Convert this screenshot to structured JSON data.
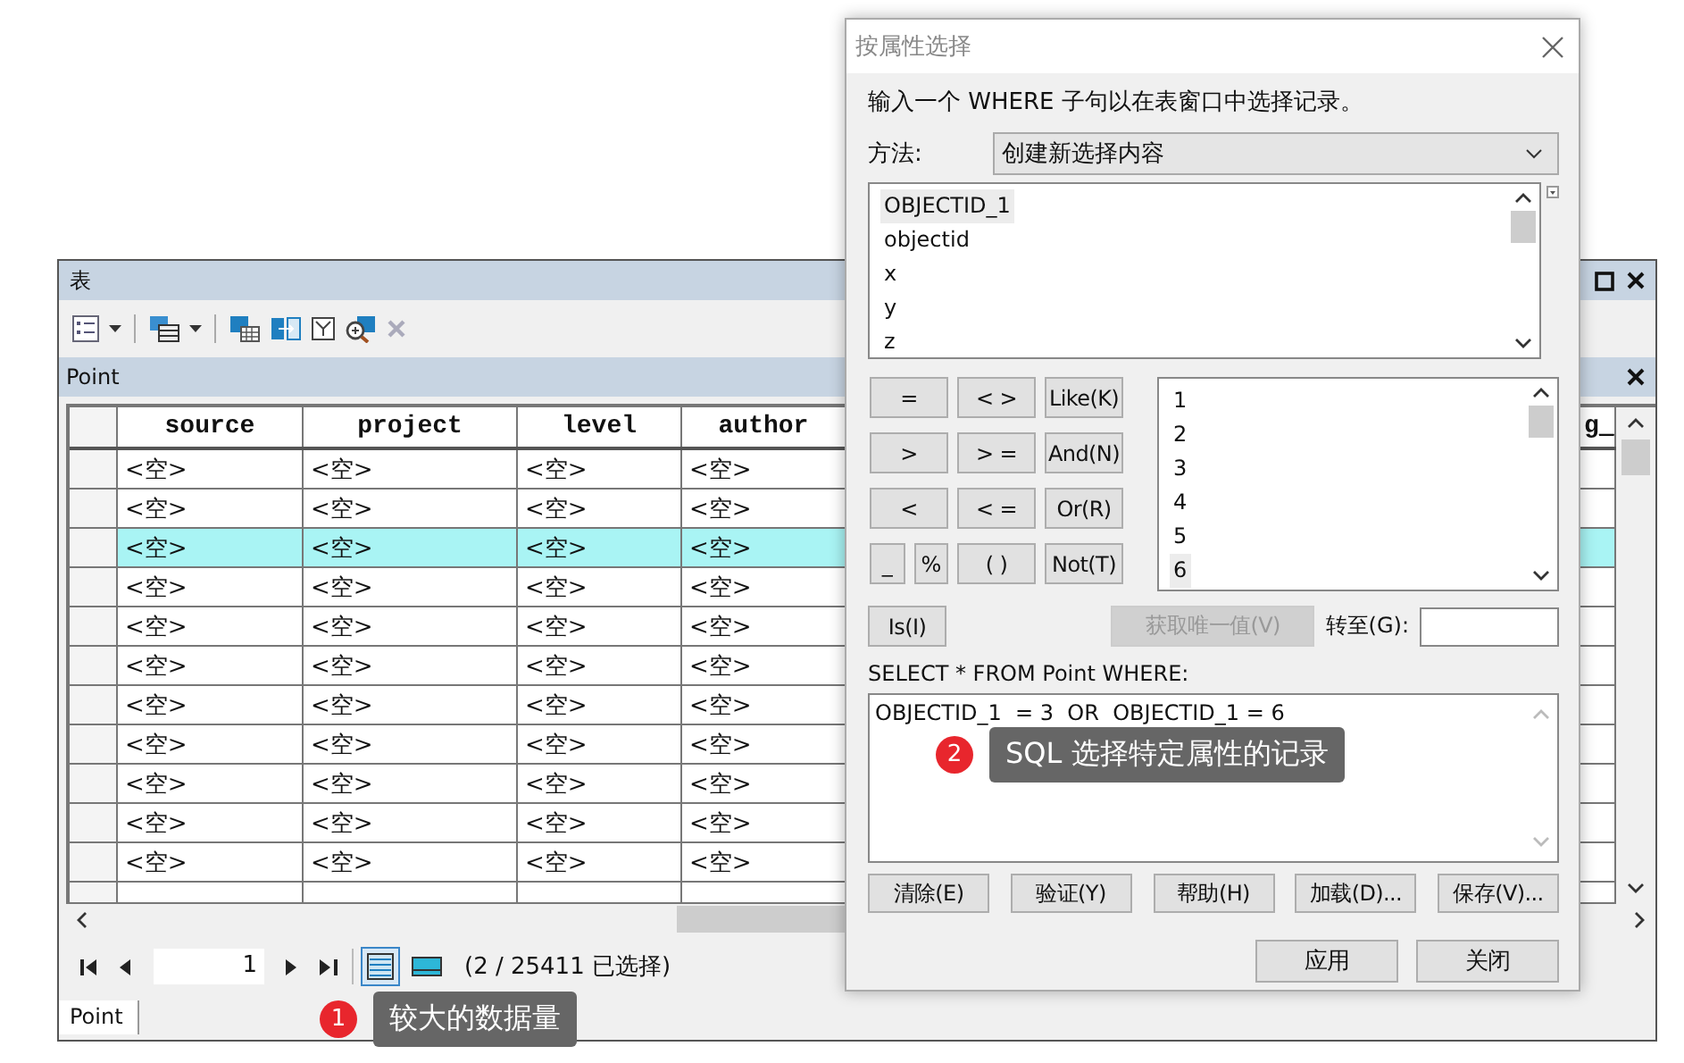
{
  "table_window": {
    "title": "表",
    "tab": "Point",
    "columns": [
      {
        "label": "source"
      },
      {
        "label": "project"
      },
      {
        "label": "level"
      },
      {
        "label": "author"
      },
      {
        "label": "g_"
      }
    ],
    "rows": [
      {
        "cells": [
          "<空>",
          "<空>",
          "<空>",
          "<空>"
        ],
        "selected": false
      },
      {
        "cells": [
          "<空>",
          "<空>",
          "<空>",
          "<空>"
        ],
        "selected": false
      },
      {
        "cells": [
          "<空>",
          "<空>",
          "<空>",
          "<空>"
        ],
        "selected": true
      },
      {
        "cells": [
          "<空>",
          "<空>",
          "<空>",
          "<空>"
        ],
        "selected": false
      },
      {
        "cells": [
          "<空>",
          "<空>",
          "<空>",
          "<空>"
        ],
        "selected": false
      },
      {
        "cells": [
          "<空>",
          "<空>",
          "<空>",
          "<空>"
        ],
        "selected": false
      },
      {
        "cells": [
          "<空>",
          "<空>",
          "<空>",
          "<空>"
        ],
        "selected": false
      },
      {
        "cells": [
          "<空>",
          "<空>",
          "<空>",
          "<空>"
        ],
        "selected": false
      },
      {
        "cells": [
          "<空>",
          "<空>",
          "<空>",
          "<空>"
        ],
        "selected": false
      },
      {
        "cells": [
          "<空>",
          "<空>",
          "<空>",
          "<空>"
        ],
        "selected": false
      },
      {
        "cells": [
          "<空>",
          "<空>",
          "<空>",
          "<空>"
        ],
        "selected": false
      }
    ],
    "page": "1",
    "selection_count": "(2 / 25411 已选择)",
    "view_buttons": [
      {
        "kind": "all",
        "selected": true
      },
      {
        "kind": "selected",
        "selected": false
      }
    ],
    "bottom_tab": "Point"
  },
  "dialog": {
    "title": "按属性选择",
    "instruction": "输入一个 WHERE 子句以在表窗口中选择记录。",
    "method_label": "方法:",
    "method": "创建新选择内容",
    "fields": [
      {
        "label": "OBJECTID_1",
        "selected": true
      },
      {
        "label": "objectid",
        "selected": false
      },
      {
        "label": "x",
        "selected": false
      },
      {
        "label": "y",
        "selected": false
      },
      {
        "label": "z",
        "selected": false
      }
    ],
    "operator_rows": [
      [
        {
          "label": "=",
          "kind": "full"
        },
        {
          "label": "< >",
          "kind": "full"
        },
        {
          "label": "Like(K)",
          "kind": "full"
        }
      ],
      [
        {
          "label": ">",
          "kind": "full"
        },
        {
          "label": "> =",
          "kind": "full"
        },
        {
          "label": "And(N)",
          "kind": "full"
        }
      ],
      [
        {
          "label": "<",
          "kind": "full"
        },
        {
          "label": "< =",
          "kind": "full"
        },
        {
          "label": "Or(R)",
          "kind": "full"
        }
      ],
      [
        {
          "label": "_",
          "kind": "half"
        },
        {
          "label": "%",
          "kind": "half"
        },
        {
          "label": "( )",
          "kind": "full"
        },
        {
          "label": "Not(T)",
          "kind": "full"
        }
      ]
    ],
    "values": [
      {
        "label": "1",
        "selected": false
      },
      {
        "label": "2",
        "selected": false
      },
      {
        "label": "3",
        "selected": false
      },
      {
        "label": "4",
        "selected": false
      },
      {
        "label": "5",
        "selected": false
      },
      {
        "label": "6",
        "selected": true
      }
    ],
    "is_button": "Is(I)",
    "unique_button": {
      "label": "获取唯一值(V)",
      "disabled": true
    },
    "goto_label": "转至(G):",
    "query_label": "SELECT * FROM Point WHERE:",
    "query": "OBJECTID_1  = 3  OR  OBJECTID_1 = 6",
    "action_buttons": [
      "清除(E)",
      "验证(Y)",
      "帮助(H)",
      "加载(D)...",
      "保存(V)..."
    ],
    "footer_buttons": [
      "应用",
      "关闭"
    ]
  },
  "callouts": [
    {
      "number": "1",
      "text": "较大的数据量"
    },
    {
      "number": "2",
      "text": "SQL 选择特定属性的记录"
    }
  ]
}
